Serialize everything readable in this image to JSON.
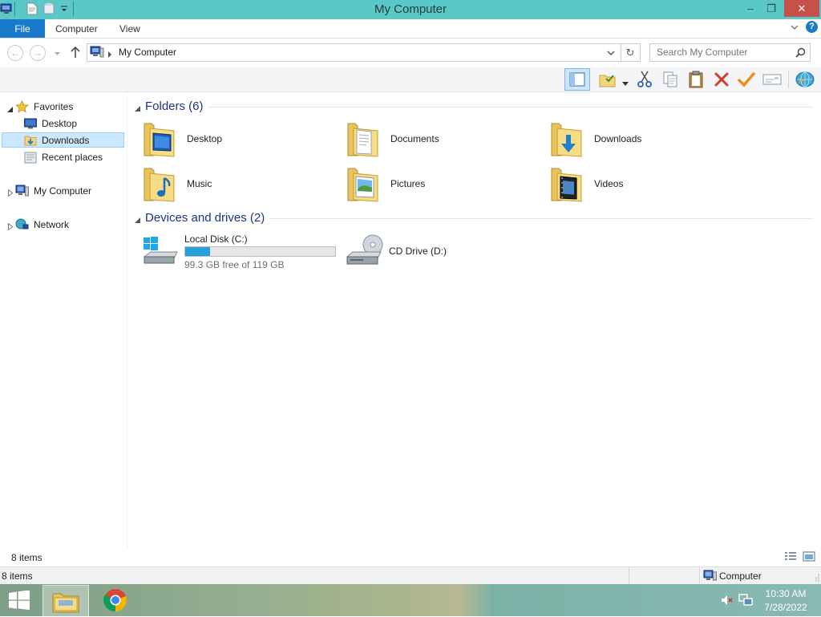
{
  "window": {
    "title": "My Computer",
    "controls": {
      "minimize": "–",
      "restore": "❐",
      "close": "✕"
    }
  },
  "ribbon": {
    "tabs": [
      "File",
      "Computer",
      "View"
    ],
    "help": "?"
  },
  "address": {
    "location_label": "My Computer",
    "search_placeholder": "Search My Computer"
  },
  "nav_pane": {
    "favorites": {
      "label": "Favorites",
      "items": [
        {
          "label": "Desktop",
          "icon": "desktop-icon"
        },
        {
          "label": "Downloads",
          "icon": "downloads-icon",
          "selected": true
        },
        {
          "label": "Recent places",
          "icon": "recent-places-icon"
        }
      ]
    },
    "my_computer": {
      "label": "My Computer"
    },
    "network": {
      "label": "Network"
    }
  },
  "content": {
    "folders_group": {
      "title": "Folders (6)",
      "items": [
        {
          "label": "Desktop",
          "icon": "desktop-folder-icon"
        },
        {
          "label": "Documents",
          "icon": "documents-folder-icon"
        },
        {
          "label": "Downloads",
          "icon": "downloads-folder-icon"
        },
        {
          "label": "Music",
          "icon": "music-folder-icon"
        },
        {
          "label": "Pictures",
          "icon": "pictures-folder-icon"
        },
        {
          "label": "Videos",
          "icon": "videos-folder-icon"
        }
      ]
    },
    "devices_group": {
      "title": "Devices and drives (2)",
      "drives": [
        {
          "label": "Local Disk (C:)",
          "free_text": "99.3 GB free of 119 GB",
          "used_fraction": 0.166,
          "icon": "local-disk-icon"
        },
        {
          "label": "CD Drive (D:)",
          "icon": "cd-drive-icon"
        }
      ]
    }
  },
  "status": {
    "items_count": "8 items",
    "bottom_items": "8 items",
    "bottom_location": "Computer"
  },
  "taskbar": {
    "time": "10:30 AM",
    "date": "7/28/2022"
  },
  "colors": {
    "titlebar": "#5bc8c8",
    "file_tab": "#1979ca",
    "group_header": "#1e3287",
    "selection": "#cce8ff",
    "drive_fill": "#26a0da"
  }
}
